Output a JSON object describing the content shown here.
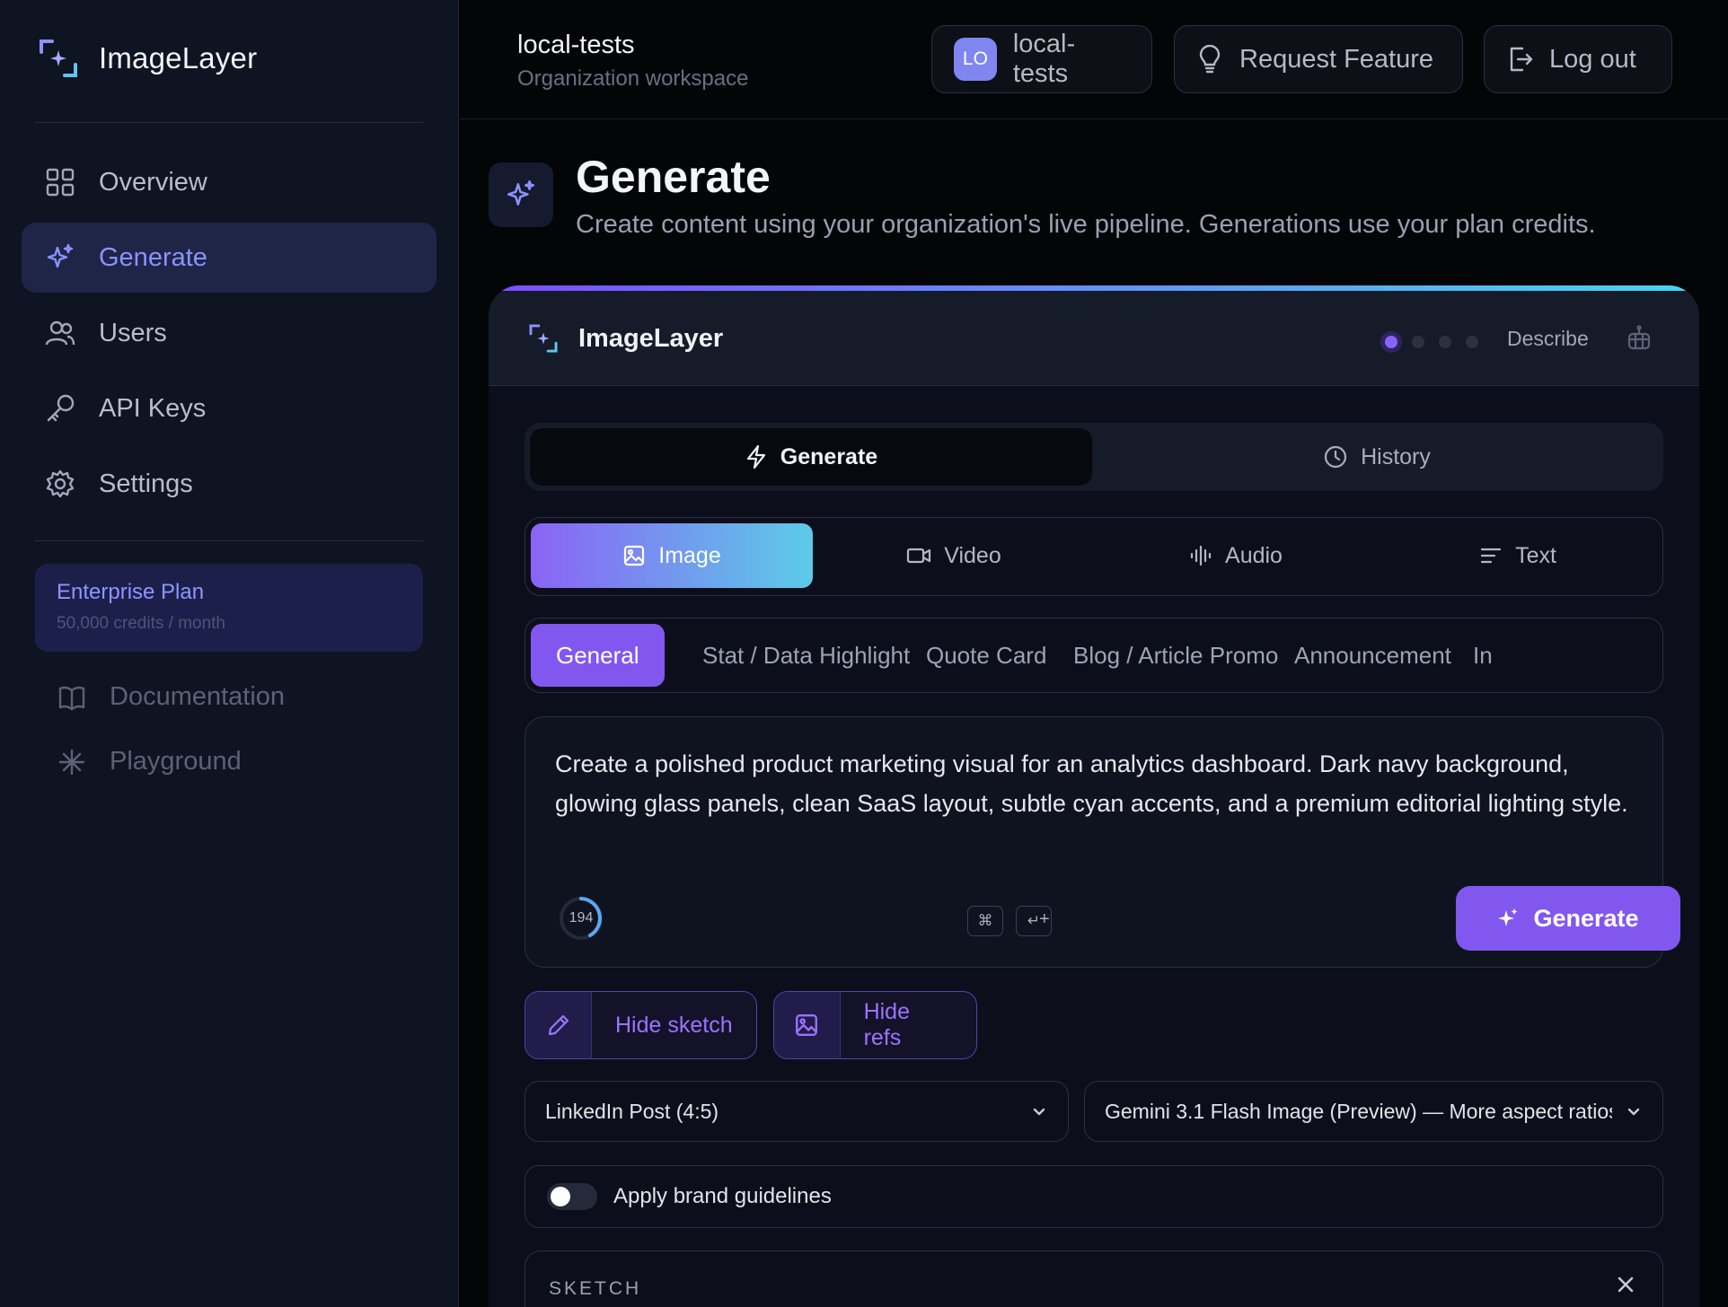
{
  "sidebar": {
    "brand": "ImageLayer",
    "nav": [
      {
        "label": "Overview",
        "icon": "grid-icon"
      },
      {
        "label": "Generate",
        "icon": "sparkles-icon",
        "active": true
      },
      {
        "label": "Users",
        "icon": "users-icon"
      },
      {
        "label": "API Keys",
        "icon": "key-icon"
      },
      {
        "label": "Settings",
        "icon": "gear-icon"
      }
    ],
    "plan": {
      "title": "Enterprise Plan",
      "subtitle": "50,000 credits / month"
    },
    "links": [
      {
        "label": "Documentation",
        "icon": "book-icon"
      },
      {
        "label": "Playground",
        "icon": "asterisk-icon"
      }
    ]
  },
  "topbar": {
    "org_name": "local-tests",
    "org_sub": "Organization workspace",
    "workspace_badge": "LO",
    "workspace_label": "local-tests",
    "request_feature": "Request Feature",
    "logout": "Log out"
  },
  "header": {
    "title": "Generate",
    "subtitle": "Create content using your organization's live pipeline. Generations use your plan credits."
  },
  "panel": {
    "brand": "ImageLayer",
    "describe": "Describe",
    "steps_total": 4,
    "step_active": 1,
    "tabs": {
      "generate": "Generate",
      "history": "History"
    },
    "types": [
      {
        "label": "Image",
        "icon": "image-icon",
        "active": true
      },
      {
        "label": "Video",
        "icon": "video-icon"
      },
      {
        "label": "Audio",
        "icon": "audio-wave-icon"
      },
      {
        "label": "Text",
        "icon": "text-lines-icon"
      }
    ],
    "templates": [
      "General",
      "Stat / Data Highlight",
      "Quote Card",
      "Blog / Article Promo",
      "Announcement",
      "In"
    ],
    "prompt": "Create a polished product marketing visual for an analytics dashboard. Dark navy background, glowing glass panels, clean SaaS layout, subtle cyan accents, and a premium editorial lighting style.",
    "char_count": "194",
    "shortcut": {
      "mod": "⌘",
      "plus": "+",
      "enter": "↵"
    },
    "generate_button": "Generate",
    "hide_sketch": "Hide sketch",
    "hide_refs": "Hide refs",
    "format_select": "LinkedIn Post (4:5)",
    "model_select": "Gemini 3.1 Flash Image (Preview) — More aspect ratios",
    "brand_guidelines": "Apply brand guidelines",
    "brand_guidelines_on": false,
    "sketch_label": "SKETCH"
  },
  "colors": {
    "accent": "#8257f0",
    "accent_light": "#8b92ff",
    "gradient_start": "#7c4dff",
    "gradient_end": "#47d4ef",
    "sidebar_bg": "#0f1422",
    "page_bg": "#040507"
  }
}
